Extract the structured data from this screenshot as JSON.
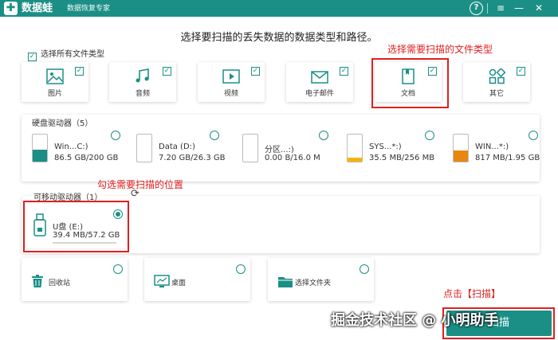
{
  "window": {
    "app_name": "数据蛙",
    "app_subtitle": "数据恢复专家",
    "logo_glyph": "✚",
    "help_label": "?",
    "menu_icon": "≡",
    "minimize_icon": "—",
    "close_icon": "✕"
  },
  "prompt": "选择要扫描的丢失数据的数据类型和路径。",
  "select_all": {
    "label": "选择所有文件类型",
    "checked": true
  },
  "file_types": [
    {
      "label": "图片",
      "icon": "picture-icon",
      "checked": true
    },
    {
      "label": "音频",
      "icon": "audio-icon",
      "checked": true
    },
    {
      "label": "视频",
      "icon": "video-icon",
      "checked": true
    },
    {
      "label": "电子邮件",
      "icon": "email-icon",
      "checked": true
    },
    {
      "label": "文档",
      "icon": "document-icon",
      "checked": true
    },
    {
      "label": "其它",
      "icon": "other-icon",
      "checked": true
    }
  ],
  "hard_drives": {
    "title": "硬盘驱动器（5）",
    "items": [
      {
        "name": "Win...C:)",
        "size": "86.5 GB/200 GB",
        "fill_fraction": 0.43,
        "fill_color": "#1b8f86"
      },
      {
        "name": "Data (D:)",
        "size": "7.20 GB/26.3 GB",
        "fill_fraction": 0.0,
        "fill_color": "#1b8f86"
      },
      {
        "name": "分区...:)",
        "size": "0.00  B/16.0 M",
        "fill_fraction": 0.0,
        "fill_color": "#f5a623"
      },
      {
        "name": "SYS...*:)",
        "size": "35.5 MB/256 MB",
        "fill_fraction": 0.14,
        "fill_color": "#f5b400"
      },
      {
        "name": "WIN...*:)",
        "size": "817 MB/1.95 GB",
        "fill_fraction": 0.42,
        "fill_color": "#e8870e"
      }
    ]
  },
  "removable_drives": {
    "title": "可移动驱动器（1）",
    "refresh_icon": "⟳",
    "items": [
      {
        "name": "U盘 (E:)",
        "size": "39.4 MB/57.2 GB",
        "selected": true
      }
    ]
  },
  "locations": [
    {
      "label": "回收站",
      "icon": "recycle-bin-icon"
    },
    {
      "label": "桌面",
      "icon": "desktop-icon"
    },
    {
      "label": "选择文件夹",
      "icon": "folder-icon"
    }
  ],
  "annotations": {
    "file_type": "选择需要扫描的文件类型",
    "location": "勾选需要扫描的位置",
    "scan": "点击【扫描】"
  },
  "scan_button": "扫描",
  "watermark": "掘金技术社区 @ 小明助手",
  "colors": {
    "accent": "#1b8f86",
    "annotation": "#e02020"
  }
}
